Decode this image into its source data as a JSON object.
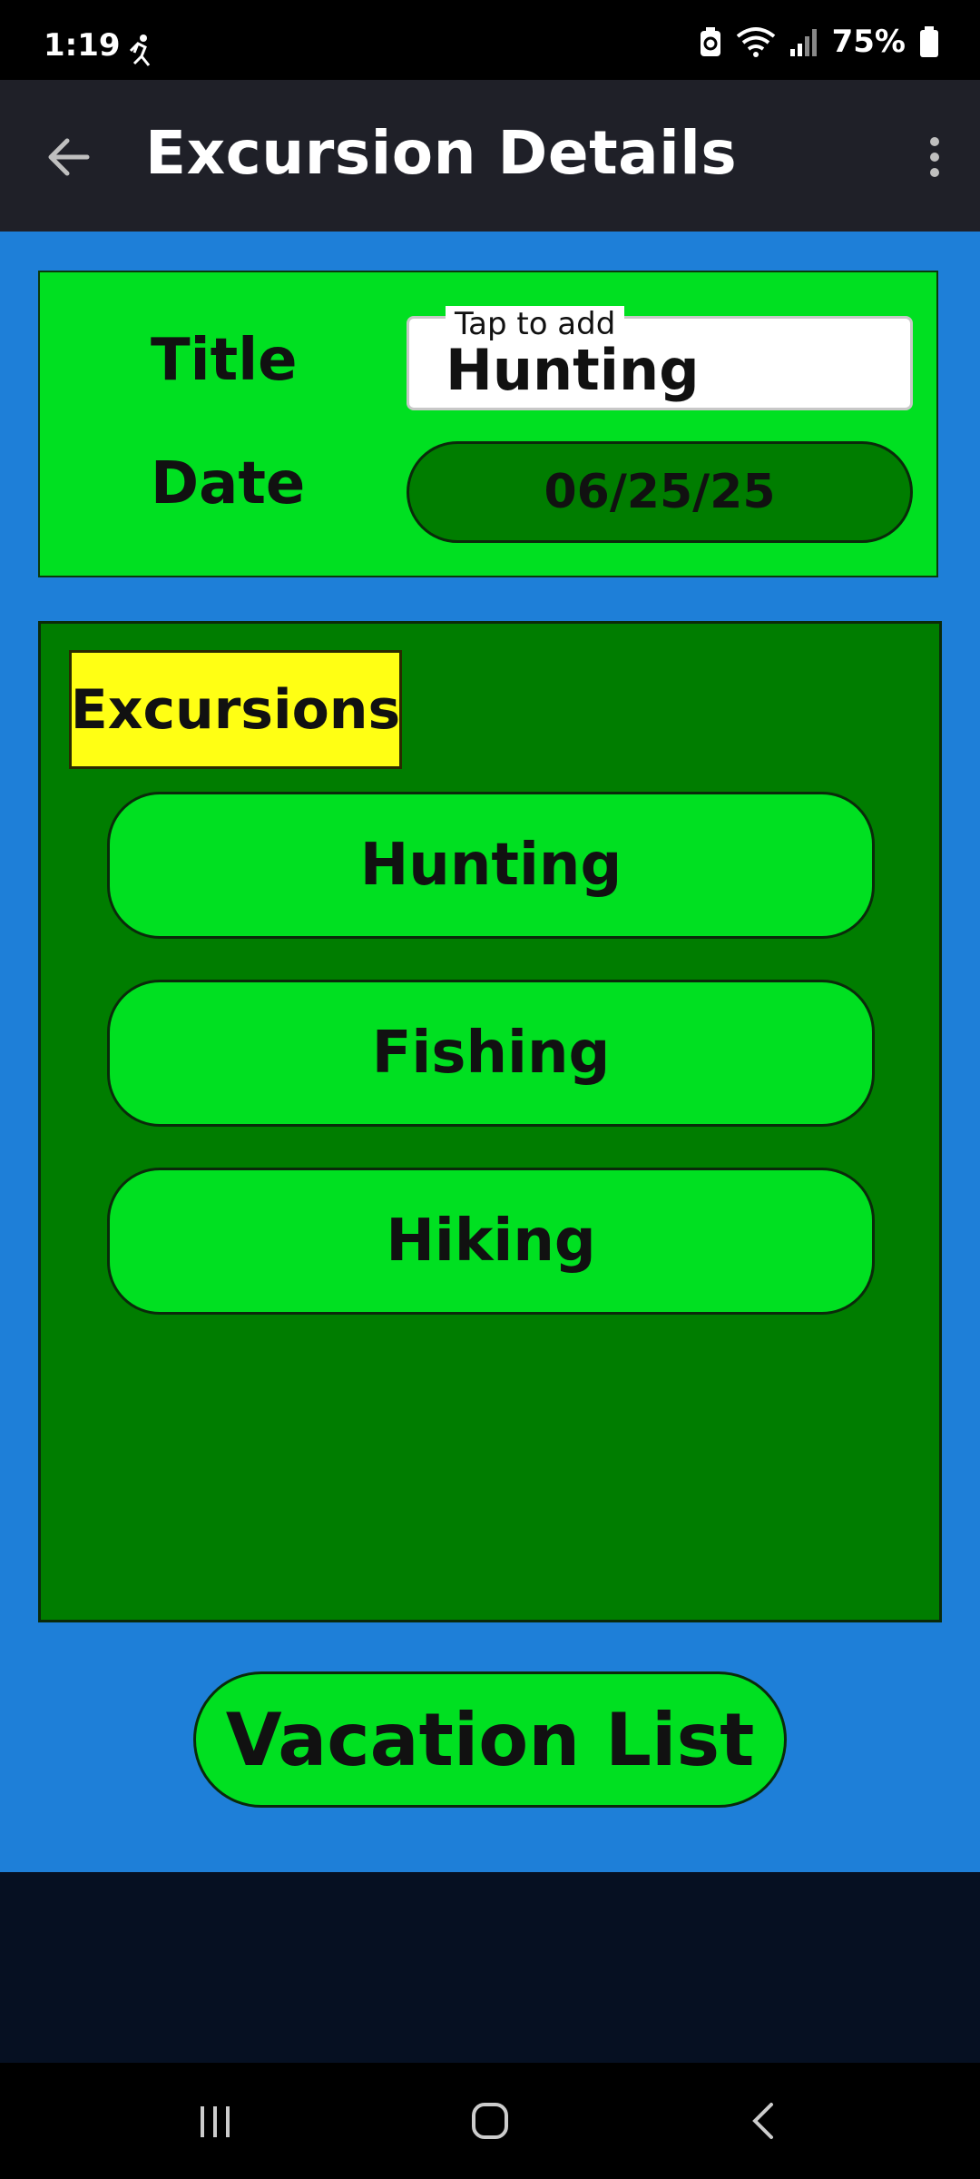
{
  "status_bar": {
    "time": "1:19",
    "battery": "75%",
    "icons": [
      "activity-icon",
      "battery-saver-icon",
      "wifi-icon",
      "signal-icon",
      "battery-icon"
    ]
  },
  "app_bar": {
    "title": "Excursion Details",
    "back_icon": "arrow-back-icon",
    "menu_icon": "more-vert-icon"
  },
  "form": {
    "title_label": "Title",
    "title_hint": "Tap to add",
    "title_value": "Hunting",
    "date_label": "Date",
    "date_value": "06/25/25"
  },
  "excursions": {
    "header": "Excursions",
    "items": [
      {
        "label": "Hunting"
      },
      {
        "label": "Fishing"
      },
      {
        "label": "Hiking"
      }
    ]
  },
  "footer": {
    "vacation_list_label": "Vacation List"
  },
  "colors": {
    "background": "#1e7fd8",
    "panel_green": "#00e021",
    "dark_green": "#007d00",
    "header_yellow": "#ffff14",
    "app_bar": "#1f2028"
  }
}
